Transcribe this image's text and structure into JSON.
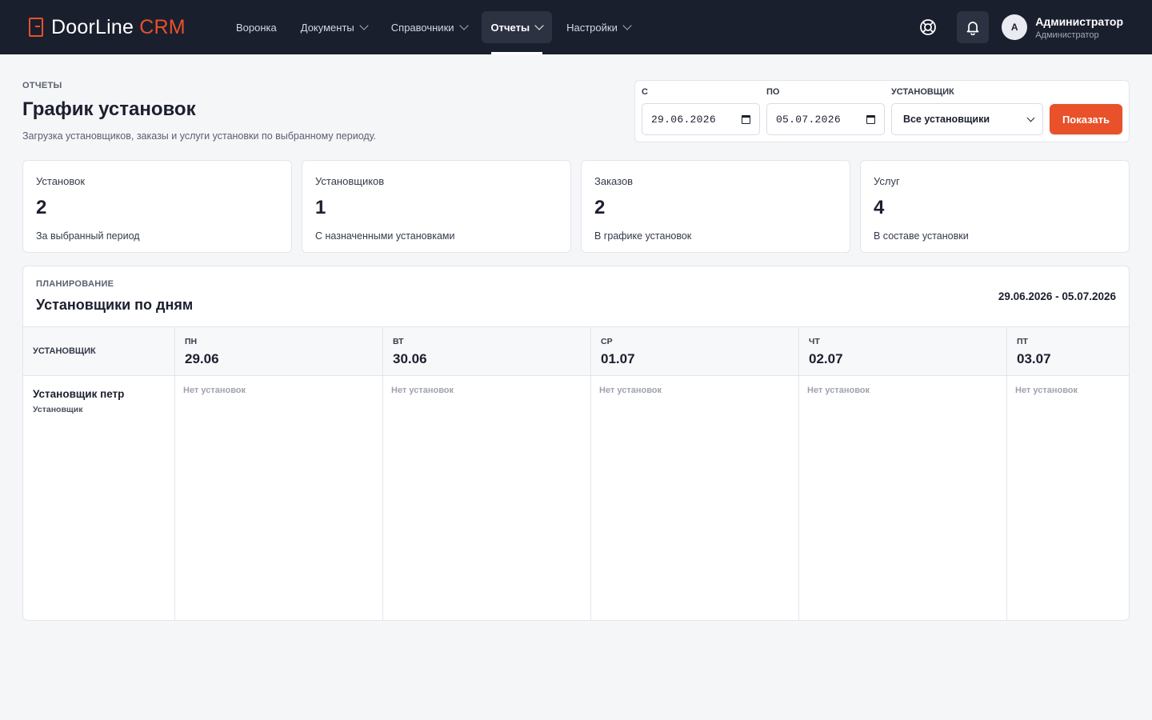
{
  "brand": {
    "name": "DoorLine",
    "suffix": "CRM",
    "accent": "#e8512a"
  },
  "nav": {
    "items": [
      {
        "label": "Воронка",
        "dropdown": false
      },
      {
        "label": "Документы",
        "dropdown": true
      },
      {
        "label": "Справочники",
        "dropdown": true
      },
      {
        "label": "Отчеты",
        "dropdown": true,
        "active": true
      },
      {
        "label": "Настройки",
        "dropdown": true
      }
    ]
  },
  "user": {
    "initial": "A",
    "name": "Администратор",
    "role": "Администратор"
  },
  "page": {
    "breadcrumb": "ОТЧЕТЫ",
    "title": "График установок",
    "subtitle": "Загрузка установщиков, заказы и услуги установки по выбранному периоду."
  },
  "filters": {
    "from_label": "С",
    "from_value": "29.06.2026",
    "to_label": "ПО",
    "to_value": "05.07.2026",
    "installer_label": "УСТАНОВЩИК",
    "installer_value": "Все установщики",
    "submit_label": "Показать"
  },
  "stats": [
    {
      "label": "Установок",
      "value": "2",
      "note": "За выбранный период"
    },
    {
      "label": "Установщиков",
      "value": "1",
      "note": "С назначенными установками"
    },
    {
      "label": "Заказов",
      "value": "2",
      "note": "В графике установок"
    },
    {
      "label": "Услуг",
      "value": "4",
      "note": "В составе установки"
    }
  ],
  "schedule": {
    "section": "ПЛАНИРОВАНИЕ",
    "title": "Установщики по дням",
    "range": "29.06.2026 - 05.07.2026",
    "first_col_label": "УСТАНОВЩИК",
    "days": [
      {
        "dow": "ПН",
        "date": "29.06"
      },
      {
        "dow": "ВТ",
        "date": "30.06"
      },
      {
        "dow": "СР",
        "date": "01.07"
      },
      {
        "dow": "ЧТ",
        "date": "02.07"
      },
      {
        "dow": "ПТ",
        "date": "03.07"
      }
    ],
    "rows": [
      {
        "name": "Установщик петр",
        "role": "Установщик",
        "cells": [
          "Нет установок",
          "Нет установок",
          "Нет установок",
          "Нет установок",
          "Нет установок"
        ]
      }
    ]
  }
}
